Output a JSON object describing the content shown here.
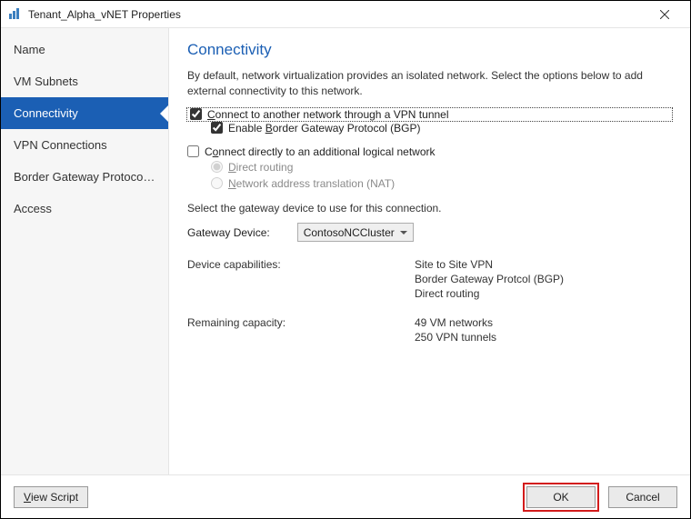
{
  "window": {
    "title": "Tenant_Alpha_vNET Properties"
  },
  "sidebar": {
    "items": [
      {
        "label": "Name"
      },
      {
        "label": "VM Subnets"
      },
      {
        "label": "Connectivity"
      },
      {
        "label": "VPN Connections"
      },
      {
        "label": "Border Gateway Protocol..."
      },
      {
        "label": "Access"
      }
    ],
    "active_index": 2
  },
  "content": {
    "title": "Connectivity",
    "description": "By default, network virtualization provides an isolated network. Select the options below to add external connectivity to this network.",
    "opt_vpn": {
      "label_pre": "",
      "label_u": "C",
      "label_post": "onnect to another network through a VPN tunnel",
      "checked": true
    },
    "opt_bgp": {
      "label_pre": "Enable ",
      "label_u": "B",
      "label_post": "order Gateway Protocol (BGP)",
      "checked": true
    },
    "opt_direct": {
      "label_pre": "C",
      "label_u": "o",
      "label_post": "nnect directly to an additional logical network",
      "checked": false
    },
    "radio_direct": {
      "label_pre": "",
      "label_u": "D",
      "label_post": "irect routing",
      "selected": true
    },
    "radio_nat": {
      "label_pre": "",
      "label_u": "N",
      "label_post": "etwork address translation (NAT)",
      "selected": false
    },
    "gateway_prompt": "Select the gateway device to use for this connection.",
    "gateway_label_pre": "",
    "gateway_label_u": "G",
    "gateway_label_post": "ateway Device:",
    "gateway_selected": "ContosoNCCluster",
    "caps_label": "Device capabilities:",
    "caps_vals": [
      "Site to Site VPN",
      "Border Gateway Protcol (BGP)",
      "Direct routing"
    ],
    "remaining_label": "Remaining capacity:",
    "remaining_vals": [
      "49 VM networks",
      "250 VPN tunnels"
    ]
  },
  "footer": {
    "view_script_pre": "",
    "view_script_u": "V",
    "view_script_post": "iew Script",
    "ok": "OK",
    "cancel": "Cancel"
  }
}
